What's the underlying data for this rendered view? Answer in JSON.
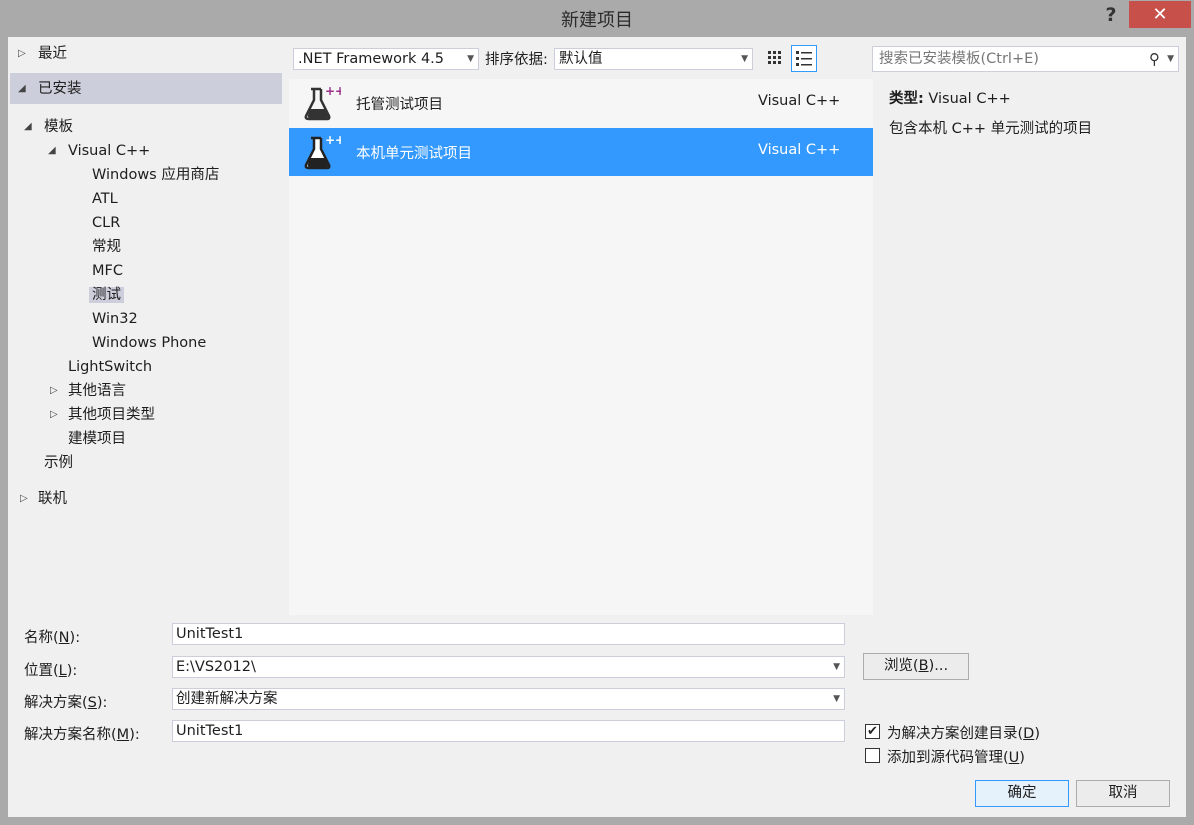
{
  "window": {
    "title": "新建项目",
    "help": "?",
    "close": "✕"
  },
  "tree": {
    "recent": "最近",
    "installed": "已安装",
    "templates": "模板",
    "visual_cpp": "Visual C++",
    "leaves": [
      "Windows 应用商店",
      "ATL",
      "CLR",
      "常规",
      "MFC",
      "测试",
      "Win32",
      "Windows Phone"
    ],
    "selected_leaf": "测试",
    "lightswitch": "LightSwitch",
    "other_languages": "其他语言",
    "other_project_types": "其他项目类型",
    "modeling_projects": "建模项目",
    "samples": "示例",
    "online": "联机"
  },
  "toolbar": {
    "framework": ".NET Framework 4.5",
    "sort_label": "排序依据:",
    "sort_value": "默认值",
    "search_placeholder": "搜索已安装模板(Ctrl+E)"
  },
  "templates": [
    {
      "name": "托管测试项目",
      "language": "Visual C++",
      "selected": false
    },
    {
      "name": "本机单元测试项目",
      "language": "Visual C++",
      "selected": true
    }
  ],
  "details": {
    "type_label": "类型:",
    "type_value": "Visual C++",
    "description": "包含本机 C++ 单元测试的项目"
  },
  "form": {
    "name_label": "名称(",
    "name_key": "N",
    "name_label_end": "):",
    "name_value": "UnitTest1",
    "location_label": "位置(",
    "location_key": "L",
    "location_label_end": "):",
    "location_value": "E:\\VS2012\\",
    "solution_label": "解决方案(",
    "solution_key": "S",
    "solution_label_end": "):",
    "solution_value": "创建新解决方案",
    "solution_name_label": "解决方案名称(",
    "solution_name_key": "M",
    "solution_name_label_end": "):",
    "solution_name_value": "UnitTest1",
    "browse": "浏览(",
    "browse_key": "B",
    "browse_end": ")...",
    "create_dir": "为解决方案创建目录(",
    "create_dir_key": "D",
    "create_dir_end": ")",
    "create_dir_checked": true,
    "add_scc": "添加到源代码管理(",
    "add_scc_key": "U",
    "add_scc_end": ")",
    "add_scc_checked": false,
    "ok": "确定",
    "cancel": "取消"
  },
  "colors": {
    "selection": "#3399ff",
    "tree_selection": "#cccedb",
    "close_button": "#c7504a",
    "icon_plus": "#9b2f8a"
  }
}
